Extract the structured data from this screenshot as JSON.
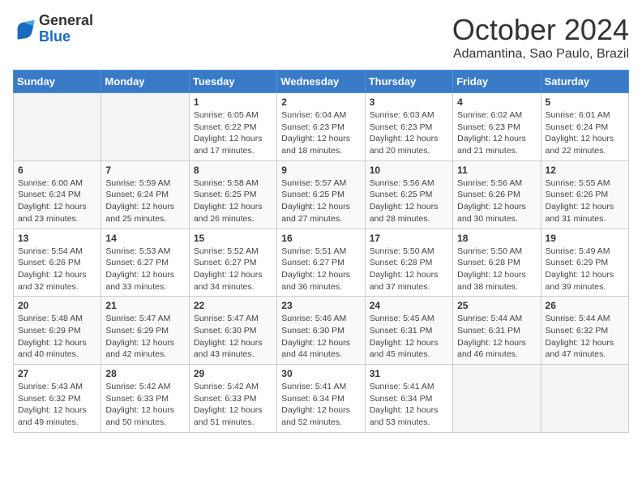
{
  "header": {
    "logo_general": "General",
    "logo_blue": "Blue",
    "month_title": "October 2024",
    "location": "Adamantina, Sao Paulo, Brazil"
  },
  "days_of_week": [
    "Sunday",
    "Monday",
    "Tuesday",
    "Wednesday",
    "Thursday",
    "Friday",
    "Saturday"
  ],
  "weeks": [
    [
      null,
      null,
      {
        "day": "1",
        "sunrise": "Sunrise: 6:05 AM",
        "sunset": "Sunset: 6:22 PM",
        "daylight": "Daylight: 12 hours and 17 minutes."
      },
      {
        "day": "2",
        "sunrise": "Sunrise: 6:04 AM",
        "sunset": "Sunset: 6:23 PM",
        "daylight": "Daylight: 12 hours and 18 minutes."
      },
      {
        "day": "3",
        "sunrise": "Sunrise: 6:03 AM",
        "sunset": "Sunset: 6:23 PM",
        "daylight": "Daylight: 12 hours and 20 minutes."
      },
      {
        "day": "4",
        "sunrise": "Sunrise: 6:02 AM",
        "sunset": "Sunset: 6:23 PM",
        "daylight": "Daylight: 12 hours and 21 minutes."
      },
      {
        "day": "5",
        "sunrise": "Sunrise: 6:01 AM",
        "sunset": "Sunset: 6:24 PM",
        "daylight": "Daylight: 12 hours and 22 minutes."
      }
    ],
    [
      {
        "day": "6",
        "sunrise": "Sunrise: 6:00 AM",
        "sunset": "Sunset: 6:24 PM",
        "daylight": "Daylight: 12 hours and 23 minutes."
      },
      {
        "day": "7",
        "sunrise": "Sunrise: 5:59 AM",
        "sunset": "Sunset: 6:24 PM",
        "daylight": "Daylight: 12 hours and 25 minutes."
      },
      {
        "day": "8",
        "sunrise": "Sunrise: 5:58 AM",
        "sunset": "Sunset: 6:25 PM",
        "daylight": "Daylight: 12 hours and 26 minutes."
      },
      {
        "day": "9",
        "sunrise": "Sunrise: 5:57 AM",
        "sunset": "Sunset: 6:25 PM",
        "daylight": "Daylight: 12 hours and 27 minutes."
      },
      {
        "day": "10",
        "sunrise": "Sunrise: 5:56 AM",
        "sunset": "Sunset: 6:25 PM",
        "daylight": "Daylight: 12 hours and 28 minutes."
      },
      {
        "day": "11",
        "sunrise": "Sunrise: 5:56 AM",
        "sunset": "Sunset: 6:26 PM",
        "daylight": "Daylight: 12 hours and 30 minutes."
      },
      {
        "day": "12",
        "sunrise": "Sunrise: 5:55 AM",
        "sunset": "Sunset: 6:26 PM",
        "daylight": "Daylight: 12 hours and 31 minutes."
      }
    ],
    [
      {
        "day": "13",
        "sunrise": "Sunrise: 5:54 AM",
        "sunset": "Sunset: 6:26 PM",
        "daylight": "Daylight: 12 hours and 32 minutes."
      },
      {
        "day": "14",
        "sunrise": "Sunrise: 5:53 AM",
        "sunset": "Sunset: 6:27 PM",
        "daylight": "Daylight: 12 hours and 33 minutes."
      },
      {
        "day": "15",
        "sunrise": "Sunrise: 5:52 AM",
        "sunset": "Sunset: 6:27 PM",
        "daylight": "Daylight: 12 hours and 34 minutes."
      },
      {
        "day": "16",
        "sunrise": "Sunrise: 5:51 AM",
        "sunset": "Sunset: 6:27 PM",
        "daylight": "Daylight: 12 hours and 36 minutes."
      },
      {
        "day": "17",
        "sunrise": "Sunrise: 5:50 AM",
        "sunset": "Sunset: 6:28 PM",
        "daylight": "Daylight: 12 hours and 37 minutes."
      },
      {
        "day": "18",
        "sunrise": "Sunrise: 5:50 AM",
        "sunset": "Sunset: 6:28 PM",
        "daylight": "Daylight: 12 hours and 38 minutes."
      },
      {
        "day": "19",
        "sunrise": "Sunrise: 5:49 AM",
        "sunset": "Sunset: 6:29 PM",
        "daylight": "Daylight: 12 hours and 39 minutes."
      }
    ],
    [
      {
        "day": "20",
        "sunrise": "Sunrise: 5:48 AM",
        "sunset": "Sunset: 6:29 PM",
        "daylight": "Daylight: 12 hours and 40 minutes."
      },
      {
        "day": "21",
        "sunrise": "Sunrise: 5:47 AM",
        "sunset": "Sunset: 6:29 PM",
        "daylight": "Daylight: 12 hours and 42 minutes."
      },
      {
        "day": "22",
        "sunrise": "Sunrise: 5:47 AM",
        "sunset": "Sunset: 6:30 PM",
        "daylight": "Daylight: 12 hours and 43 minutes."
      },
      {
        "day": "23",
        "sunrise": "Sunrise: 5:46 AM",
        "sunset": "Sunset: 6:30 PM",
        "daylight": "Daylight: 12 hours and 44 minutes."
      },
      {
        "day": "24",
        "sunrise": "Sunrise: 5:45 AM",
        "sunset": "Sunset: 6:31 PM",
        "daylight": "Daylight: 12 hours and 45 minutes."
      },
      {
        "day": "25",
        "sunrise": "Sunrise: 5:44 AM",
        "sunset": "Sunset: 6:31 PM",
        "daylight": "Daylight: 12 hours and 46 minutes."
      },
      {
        "day": "26",
        "sunrise": "Sunrise: 5:44 AM",
        "sunset": "Sunset: 6:32 PM",
        "daylight": "Daylight: 12 hours and 47 minutes."
      }
    ],
    [
      {
        "day": "27",
        "sunrise": "Sunrise: 5:43 AM",
        "sunset": "Sunset: 6:32 PM",
        "daylight": "Daylight: 12 hours and 49 minutes."
      },
      {
        "day": "28",
        "sunrise": "Sunrise: 5:42 AM",
        "sunset": "Sunset: 6:33 PM",
        "daylight": "Daylight: 12 hours and 50 minutes."
      },
      {
        "day": "29",
        "sunrise": "Sunrise: 5:42 AM",
        "sunset": "Sunset: 6:33 PM",
        "daylight": "Daylight: 12 hours and 51 minutes."
      },
      {
        "day": "30",
        "sunrise": "Sunrise: 5:41 AM",
        "sunset": "Sunset: 6:34 PM",
        "daylight": "Daylight: 12 hours and 52 minutes."
      },
      {
        "day": "31",
        "sunrise": "Sunrise: 5:41 AM",
        "sunset": "Sunset: 6:34 PM",
        "daylight": "Daylight: 12 hours and 53 minutes."
      },
      null,
      null
    ]
  ]
}
